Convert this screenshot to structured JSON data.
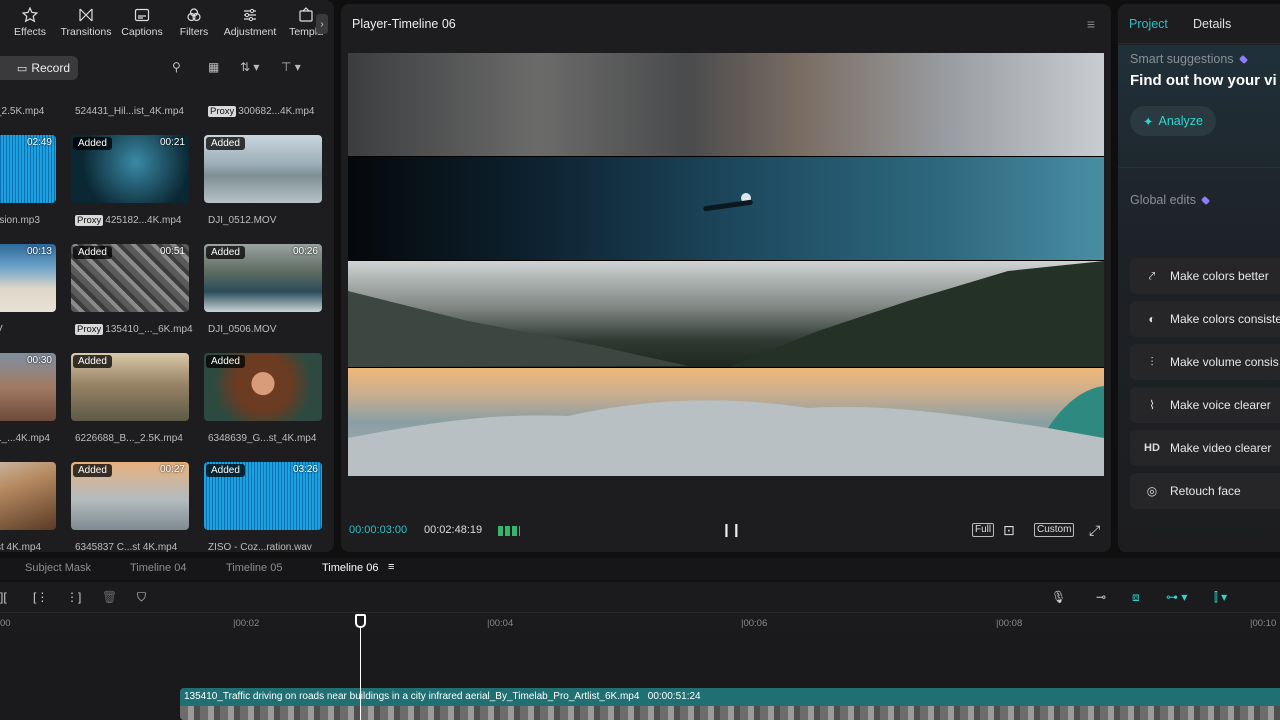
{
  "toolbar": {
    "items": [
      {
        "label": "Effects",
        "icon": "effects-star-icon"
      },
      {
        "label": "Transitions",
        "icon": "transitions-bowtie-icon"
      },
      {
        "label": "Captions",
        "icon": "captions-icon"
      },
      {
        "label": "Filters",
        "icon": "filters-icon"
      },
      {
        "label": "Adjustment",
        "icon": "adjustment-sliders-icon"
      },
      {
        "label": "Templa",
        "icon": "templates-icon"
      }
    ],
    "more": "›"
  },
  "media_bar": {
    "record_label": "Record"
  },
  "media": {
    "top_labels": [
      "_2.5K.mp4",
      "524431_Hil...ist_4K.mp4",
      "300682...4K.mp4"
    ],
    "rows": [
      {
        "tiles": [
          {
            "duration": "02:49",
            "added": false,
            "label": "rsion.mp3",
            "proxy": false,
            "color": "audio"
          },
          {
            "duration": "00:21",
            "added": true,
            "label": "425182...4K.mp4",
            "proxy": true,
            "color": "underwater"
          },
          {
            "duration": "",
            "added": true,
            "label": "DJI_0512.MOV",
            "proxy": false,
            "color": "lake"
          }
        ]
      },
      {
        "tiles": [
          {
            "duration": "00:13",
            "added": false,
            "label": "V",
            "proxy": false,
            "color": "beach"
          },
          {
            "duration": "00:51",
            "added": true,
            "label": "135410_..._6K.mp4",
            "proxy": true,
            "color": "city"
          },
          {
            "duration": "00:26",
            "added": true,
            "label": "DJI_0506.MOV",
            "proxy": false,
            "color": "coast"
          }
        ]
      },
      {
        "tiles": [
          {
            "duration": "00:30",
            "added": false,
            "label": "1_...4K.mp4",
            "proxy": false,
            "color": "canyon"
          },
          {
            "duration": "",
            "added": true,
            "label": "6226688_B..._2.5K.mp4",
            "proxy": false,
            "color": "hiker"
          },
          {
            "duration": "",
            "added": true,
            "label": "6348639_G...st_4K.mp4",
            "proxy": false,
            "color": "woman"
          }
        ]
      },
      {
        "tiles": [
          {
            "duration": "",
            "added": false,
            "label": "st 4K.mp4",
            "proxy": false,
            "color": "desert"
          },
          {
            "duration": "00:27",
            "added": true,
            "label": "6345837 C...st 4K.mp4",
            "proxy": false,
            "color": "glacier"
          },
          {
            "duration": "03:26",
            "added": true,
            "label": "ZISO - Coz...ration.wav",
            "proxy": false,
            "color": "audio"
          }
        ]
      }
    ],
    "added_label": "Added",
    "proxy_label": "Proxy"
  },
  "player": {
    "title": "Player-Timeline 06",
    "timecode_current": "00:00:03:00",
    "timecode_total": "00:02:48:19",
    "full_label": "Full",
    "custom_label": "Custom"
  },
  "right_panel": {
    "tabs": [
      "Project",
      "Details"
    ],
    "smart_label": "Smart suggestions",
    "smart_title": "Find out how your vi",
    "analyze_label": "Analyze",
    "global_label": "Global edits",
    "edits": [
      {
        "label": "Make colors better",
        "icon": "wand-icon"
      },
      {
        "label": "Make colors consiste",
        "icon": "palette-icon"
      },
      {
        "label": "Make volume consis",
        "icon": "volume-sliders-icon"
      },
      {
        "label": "Make voice clearer",
        "icon": "waveform-icon"
      },
      {
        "label": "Make video clearer",
        "icon": "hd-icon"
      },
      {
        "label": "Retouch face",
        "icon": "face-retouch-icon"
      }
    ]
  },
  "timeline": {
    "tabs": [
      "Subject Mask",
      "Timeline 04",
      "Timeline 05",
      "Timeline 06"
    ],
    "active_tab": "Timeline 06",
    "ruler": [
      "00",
      "00:02",
      "00:04",
      "00:06",
      "00:08",
      "00:10"
    ],
    "clip_name": "135410_Traffic driving on roads near buildings in a city infrared aerial_By_Timelab_Pro_Artlist_6K.mp4",
    "clip_duration": "00:00:51:24"
  },
  "colors": {
    "accent": "#2bc0c8",
    "panel": "#1d1d1f",
    "clip": "#1f6f73"
  }
}
